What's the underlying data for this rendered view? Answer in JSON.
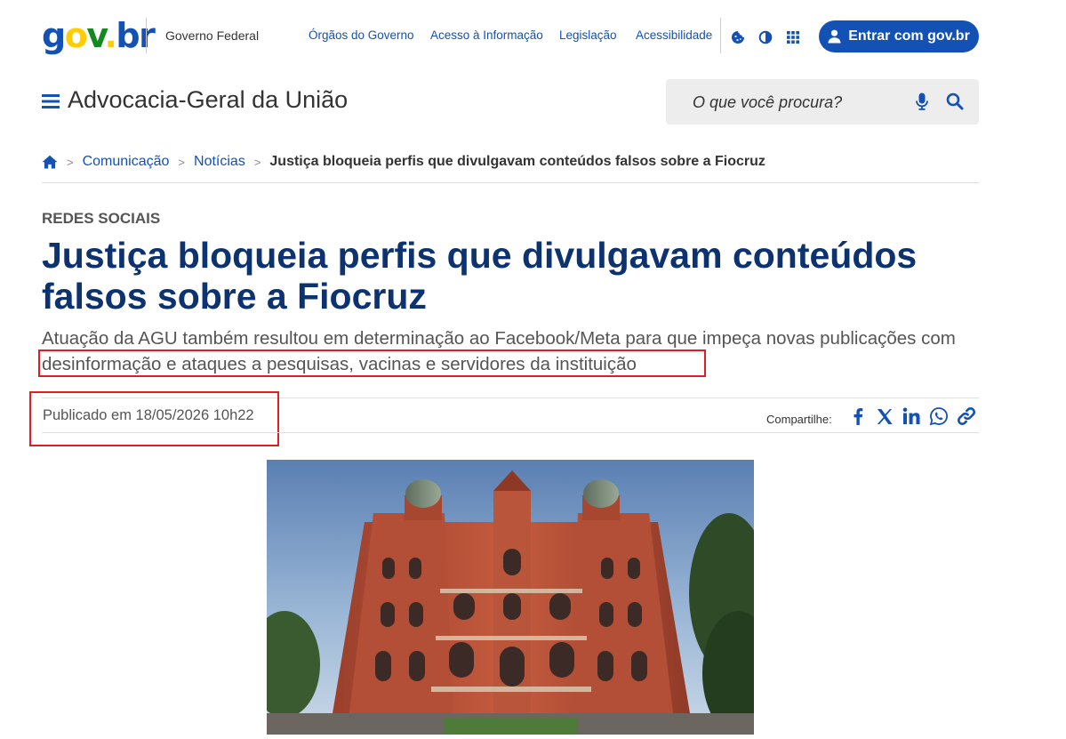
{
  "header": {
    "logo_letters": [
      "g",
      "o",
      "v",
      ".",
      "b",
      "r"
    ],
    "government_label": "Governo Federal",
    "links": [
      "Órgãos do Governo",
      "Acesso à Informação",
      "Legislação",
      "Acessibilidade"
    ],
    "icons": [
      "cookie-icon",
      "contrast-icon",
      "apps-grid-icon"
    ],
    "login_label": "Entrar com gov.br"
  },
  "site": {
    "title": "Advocacia-Geral da União",
    "search_placeholder": "O que você procura?"
  },
  "breadcrumb": {
    "items": [
      "Comunicação",
      "Notícias"
    ],
    "current": "Justiça bloqueia perfis que divulgavam conteúdos falsos sobre a Fiocruz"
  },
  "article": {
    "category": "REDES SOCIAIS",
    "title": "Justiça bloqueia perfis que divulgavam conteúdos falsos sobre a Fiocruz",
    "subtitle": "Atuação da AGU também resultou em determinação ao Facebook/Meta para que impeça novas publicações com desinformação e ataques a pesquisas, vacinas e servidores da instituição",
    "published": "Publicado em 18/05/2026 10h22",
    "share_label": "Compartilhe:",
    "share_icons": [
      "facebook-icon",
      "x-icon",
      "linkedin-icon",
      "whatsapp-icon",
      "link-icon"
    ]
  },
  "colors": {
    "primary_blue": "#1351b4",
    "headline_blue": "#0c326f",
    "highlight_red": "#e11d23",
    "logo_yellow": "#ffcd07",
    "logo_green": "#168821"
  }
}
